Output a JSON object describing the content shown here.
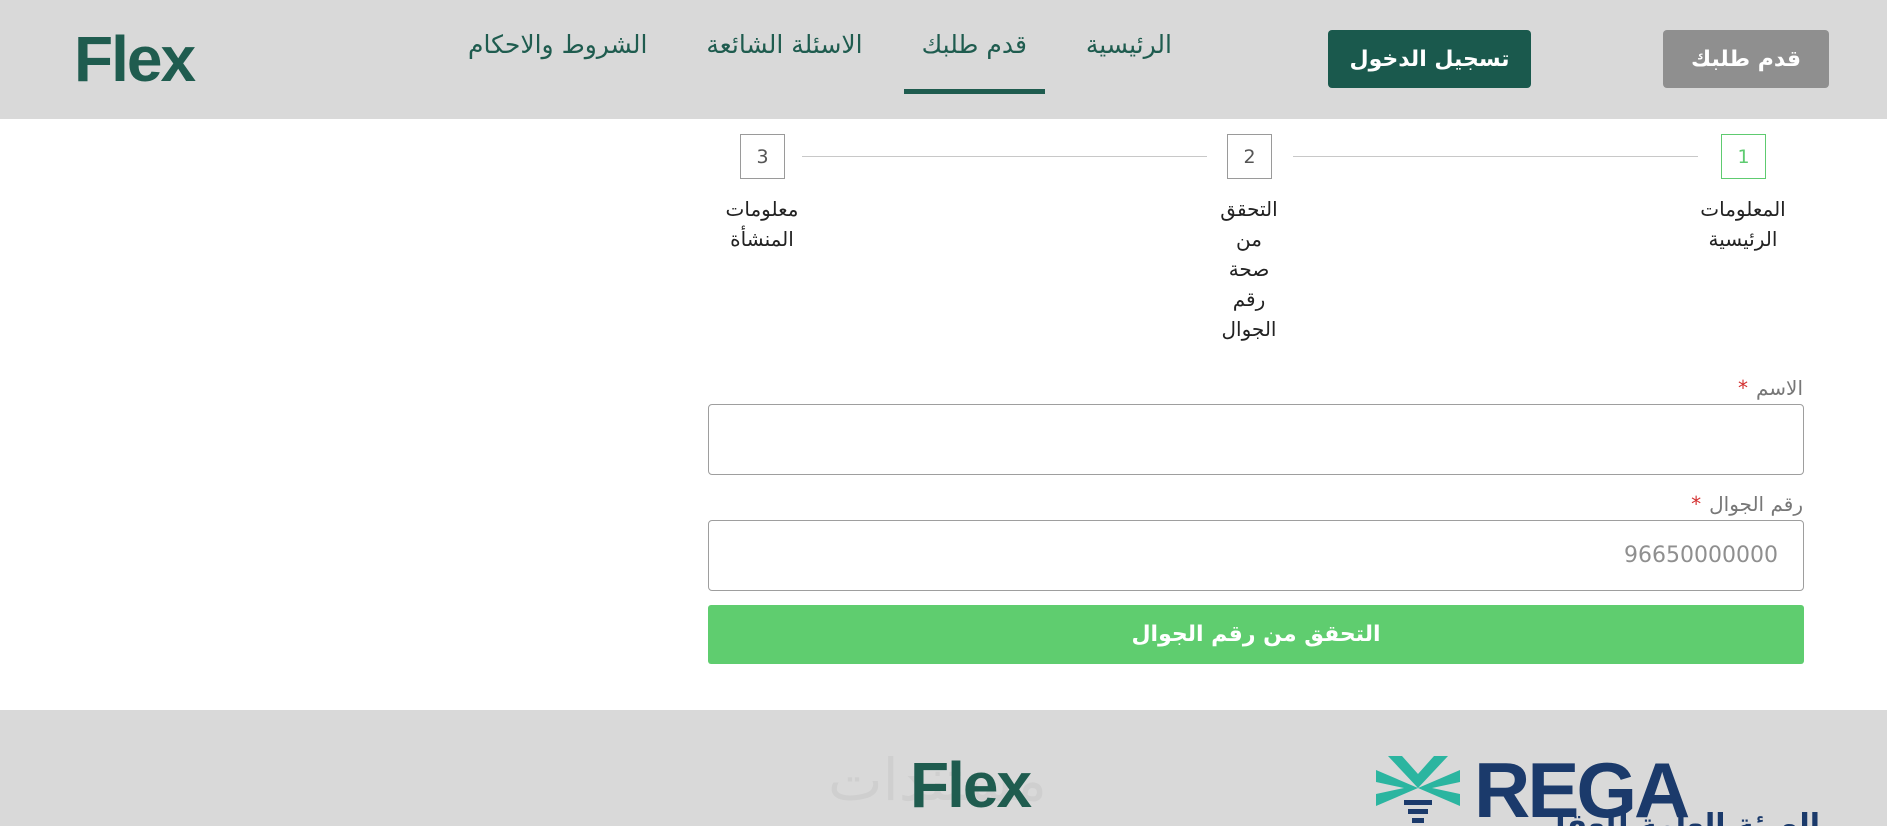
{
  "header": {
    "logo": "Flex",
    "nav": [
      {
        "label": "الرئيسية",
        "active": false
      },
      {
        "label": "قدم طلبك",
        "active": true
      },
      {
        "label": "الاسئلة الشائعة",
        "active": false
      },
      {
        "label": "الشروط والاحكام",
        "active": false
      }
    ],
    "login_button": "تسجيل الدخول",
    "apply_button": "قدم طلبك"
  },
  "stepper": {
    "steps": [
      {
        "number": "1",
        "label": "المعلومات الرئيسية",
        "active": true
      },
      {
        "number": "2",
        "label": "التحقق من صحة رقم الجوال",
        "active": false
      },
      {
        "number": "3",
        "label": "معلومات المنشأة",
        "active": false
      }
    ]
  },
  "form": {
    "name_label": "الاسم",
    "name_value": "",
    "mobile_label": "رقم الجوال",
    "mobile_placeholder": "96650000000",
    "required_mark": "*",
    "verify_button": "التحقق من رقم الجوال"
  },
  "footer": {
    "flex_logo": "Flex",
    "watermark": "مستندات",
    "rega_logo": "REGA",
    "rega_arabic": "الهيئة العامة للعقار"
  },
  "colors": {
    "brand_green": "#1a594d",
    "success_green": "#5fcd6f",
    "header_bg": "#d9d9d9",
    "rega_blue": "#1b3a6b",
    "rega_teal": "#2bb5a0"
  }
}
